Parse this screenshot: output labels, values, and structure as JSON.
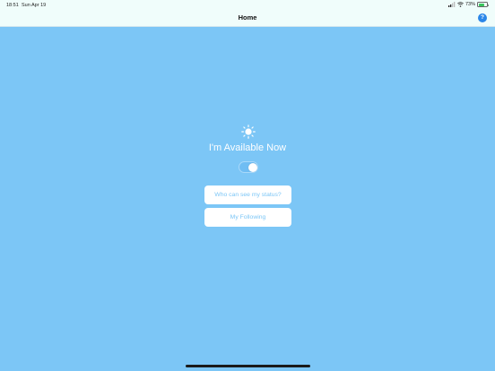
{
  "status_bar": {
    "time": "18:51",
    "date": "Sun Apr 19",
    "battery_percent": "73%",
    "battery_level": 0.73,
    "battery_color": "#3ac55e"
  },
  "nav": {
    "title": "Home",
    "help_label": "?"
  },
  "main": {
    "title": "I'm Available Now",
    "available_toggle_on": true,
    "buttons": {
      "status_visibility": "Who can see my status?",
      "following": "My Following"
    }
  },
  "colors": {
    "background": "#7cc6f6",
    "topbar": "#f0fdfb",
    "accent": "#2a86e8"
  }
}
